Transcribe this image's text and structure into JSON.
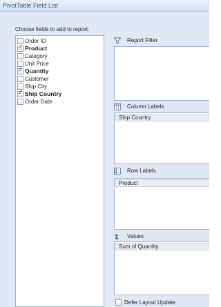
{
  "window": {
    "title": "PivotTable Field List"
  },
  "field_list": {
    "label": "Choose fields to add to report:",
    "fields": [
      {
        "label": "Order ID",
        "checked": false
      },
      {
        "label": "Product",
        "checked": true
      },
      {
        "label": "Category",
        "checked": false
      },
      {
        "label": "Unit Price",
        "checked": false
      },
      {
        "label": "Quantity",
        "checked": true
      },
      {
        "label": "Customer",
        "checked": false
      },
      {
        "label": "Ship City",
        "checked": false
      },
      {
        "label": "Ship Country",
        "checked": true
      },
      {
        "label": "Order Date",
        "checked": false
      }
    ]
  },
  "areas": {
    "report_filter": {
      "label": "Report Filter",
      "icon": "filter-icon",
      "items": []
    },
    "column_labels": {
      "label": "Column Labels",
      "icon": "column-grid-icon",
      "items": [
        "Ship Country"
      ]
    },
    "row_labels": {
      "label": "Row Labels",
      "icon": "row-grid-icon",
      "items": [
        "Product"
      ]
    },
    "values": {
      "label": "Values",
      "icon": "sigma-icon",
      "items": [
        "Sum of Quantity"
      ]
    }
  },
  "defer": {
    "label": "Defer Layout Update",
    "checked": false
  },
  "colors": {
    "pane_background": "#dfe8f4",
    "title_text": "#2a5a9a",
    "border": "#9fb3cf",
    "item_background": "#e9eef5"
  }
}
